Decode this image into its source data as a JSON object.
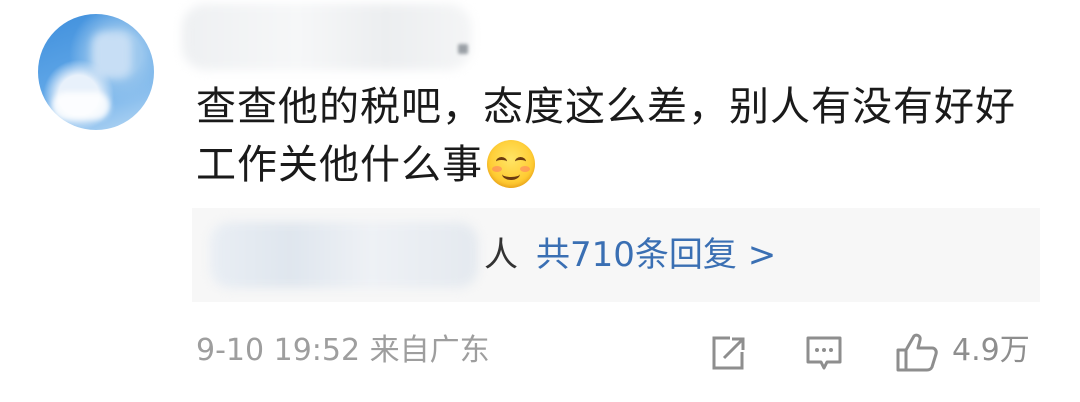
{
  "comment": {
    "line1": "查查他的税吧，态度这么差，别人有没有好好",
    "line2": "工作关他什么事",
    "emoji": "smiling-face-emoji"
  },
  "replies": {
    "name_suffix": "人",
    "count_label": "共710条回复 >"
  },
  "footer": {
    "timestamp": "9-10 19:52 来自广东",
    "like_count": "4.9万"
  },
  "colors": {
    "text": "#1a1a1a",
    "link": "#3a6fb3",
    "meta": "#9e9e9e",
    "reply_bg": "#f7f7f7"
  }
}
